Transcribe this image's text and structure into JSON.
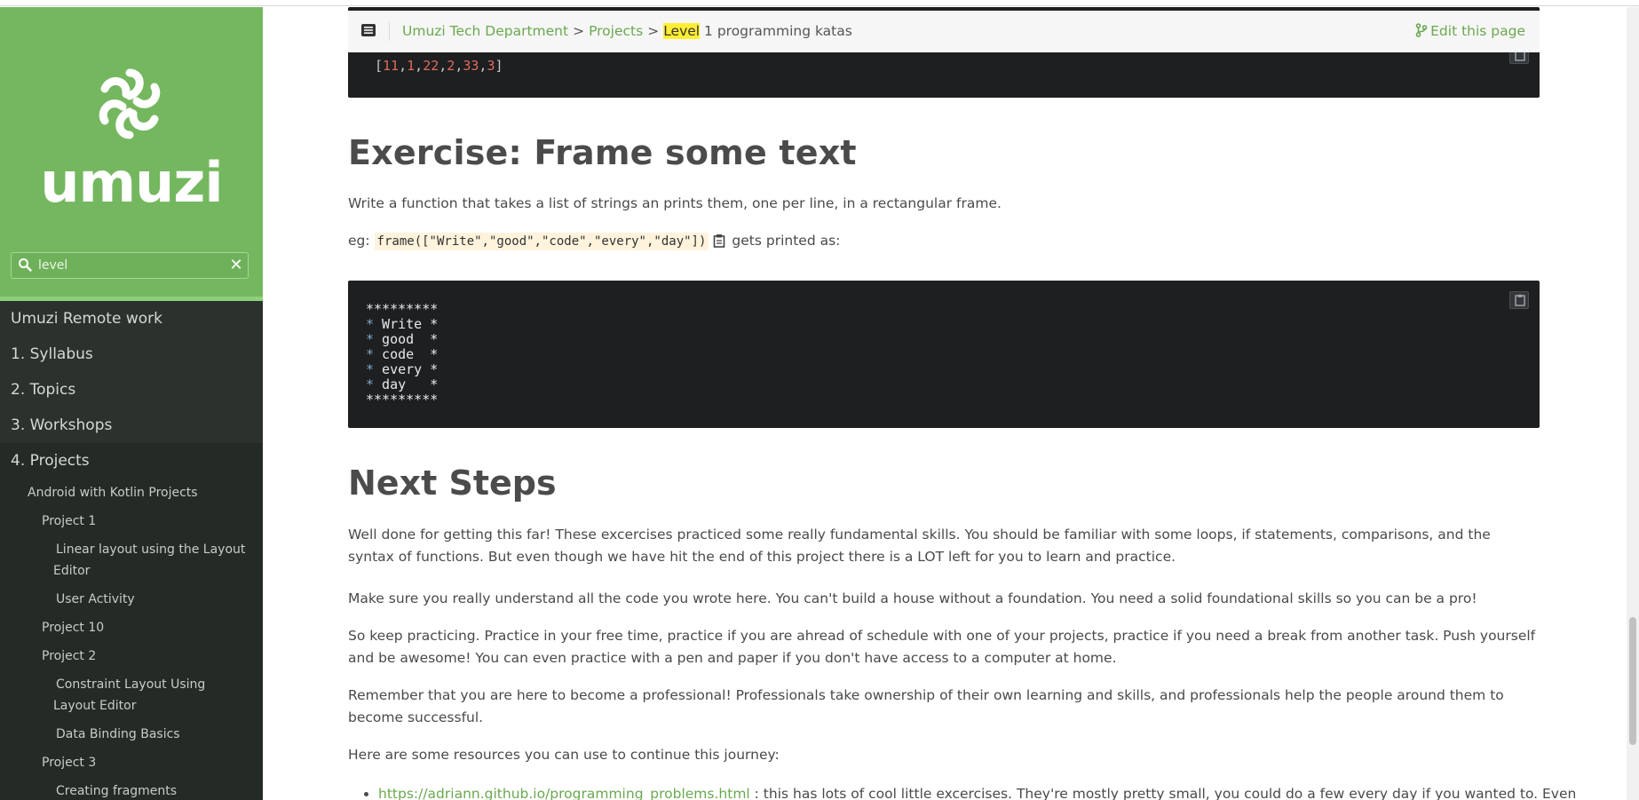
{
  "sidebar": {
    "logo_text": "umuzi",
    "search": {
      "value": "level"
    },
    "nav": {
      "remote": "Umuzi Remote work",
      "syllabus": "1. Syllabus",
      "topics": "2. Topics",
      "workshops": "3. Workshops",
      "projects": "4. Projects",
      "android": "Android with Kotlin Projects",
      "project1": "Project 1",
      "linear_layout": "Linear layout using the Layout Editor",
      "user_activity": "User Activity",
      "project10": "Project 10",
      "project2": "Project 2",
      "constraint_layout": "Constraint Layout Using Layout Editor",
      "data_binding": "Data Binding Basics",
      "project3": "Project 3",
      "partial": "Creating fragments"
    }
  },
  "topbar": {
    "breadcrumb": {
      "dept": "Umuzi Tech Department",
      "sep": ">",
      "projects": "Projects",
      "highlight": "Level",
      "rest": " 1 programming katas"
    },
    "edit": "Edit this page"
  },
  "content": {
    "code1": {
      "open": "[",
      "n1": "11",
      "n2": "1",
      "n3": "22",
      "n4": "2",
      "n5": "33",
      "n6": "3",
      "comma": ",",
      "close": "]"
    },
    "frame_heading": "Exercise: Frame some text",
    "frame_desc": "Write a function that takes a list of strings an prints them, one per line, in a rectangular frame.",
    "frame_eg": "eg:",
    "frame_call": "frame([\"Write\",\"good\",\"code\",\"every\",\"day\"])",
    "frame_after": "gets printed as:",
    "frame_output": [
      "*********",
      "* Write *",
      "* good  *",
      "* code  *",
      "* every *",
      "* day   *",
      "*********"
    ],
    "next_heading": "Next Steps",
    "p1": "Well done for getting this far! These excercises practiced some really fundamental skills. You should be familiar with some loops, if statements, comparisons, and the syntax of functions. But even though we have hit the end of this project there is a LOT left for you to learn and practice.",
    "p2": "Make sure you really understand all the code you wrote here. You can't build a house without a foundation. You need a solid foundational skills so you can be a pro!",
    "p3": "So keep practicing. Practice in your free time, practice if you are ahread of schedule with one of your projects, practice if you need a break from another task. Push yourself and be awesome! You can even practice with a pen and paper if you don't have access to a computer at home.",
    "p4": "Remember that you are here to become a professional! Professionals take ownership of their own learning and skills, and professionals help the people around them to become successful.",
    "p5": "Here are some resources you can use to continue this journey:",
    "resource_link": "https://adriann.github.io/programming_problems.html",
    "resource_text": " : this has lots of cool little excercises. They're mostly pretty small, you could do a few every day if you wanted to. Even"
  },
  "colors": {
    "sidebar_green": "#74b75f",
    "sidebar_dark": "#2b312c",
    "link_green": "#6aa84f",
    "highlight": "#ffee33",
    "code_bg": "#1d1f21"
  }
}
